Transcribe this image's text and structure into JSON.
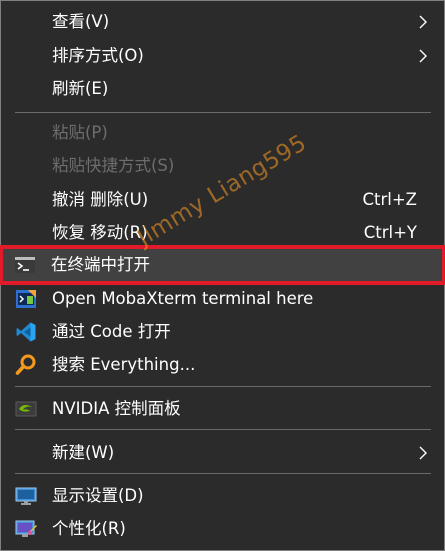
{
  "menu": {
    "items": [
      {
        "label": "查看(V)",
        "submenu": true
      },
      {
        "label": "排序方式(O)",
        "submenu": true
      },
      {
        "label": "刷新(E)"
      },
      {
        "label": "粘贴(P)",
        "disabled": true
      },
      {
        "label": "粘贴快捷方式(S)",
        "disabled": true
      },
      {
        "label": "撤消 删除(U)",
        "shortcut": "Ctrl+Z"
      },
      {
        "label": "恢复 移动(R)",
        "shortcut": "Ctrl+Y"
      },
      {
        "label": "在终端中打开",
        "icon": "terminal-icon",
        "highlighted": true
      },
      {
        "label": "Open MobaXterm terminal here",
        "icon": "mobaxterm-icon"
      },
      {
        "label": "通过 Code 打开",
        "icon": "vscode-icon"
      },
      {
        "label": "搜索 Everything...",
        "icon": "everything-search-icon"
      },
      {
        "label": "NVIDIA 控制面板",
        "icon": "nvidia-icon"
      },
      {
        "label": "新建(W)",
        "submenu": true
      },
      {
        "label": "显示设置(D)",
        "icon": "display-settings-icon"
      },
      {
        "label": "个性化(R)",
        "icon": "personalize-icon"
      }
    ]
  },
  "watermark": "Jimmy Liang595",
  "colors": {
    "background": "#2b2b2b",
    "highlight_border": "#e21b2a",
    "disabled_text": "#6d6d6d",
    "watermark": "#e48e24"
  }
}
